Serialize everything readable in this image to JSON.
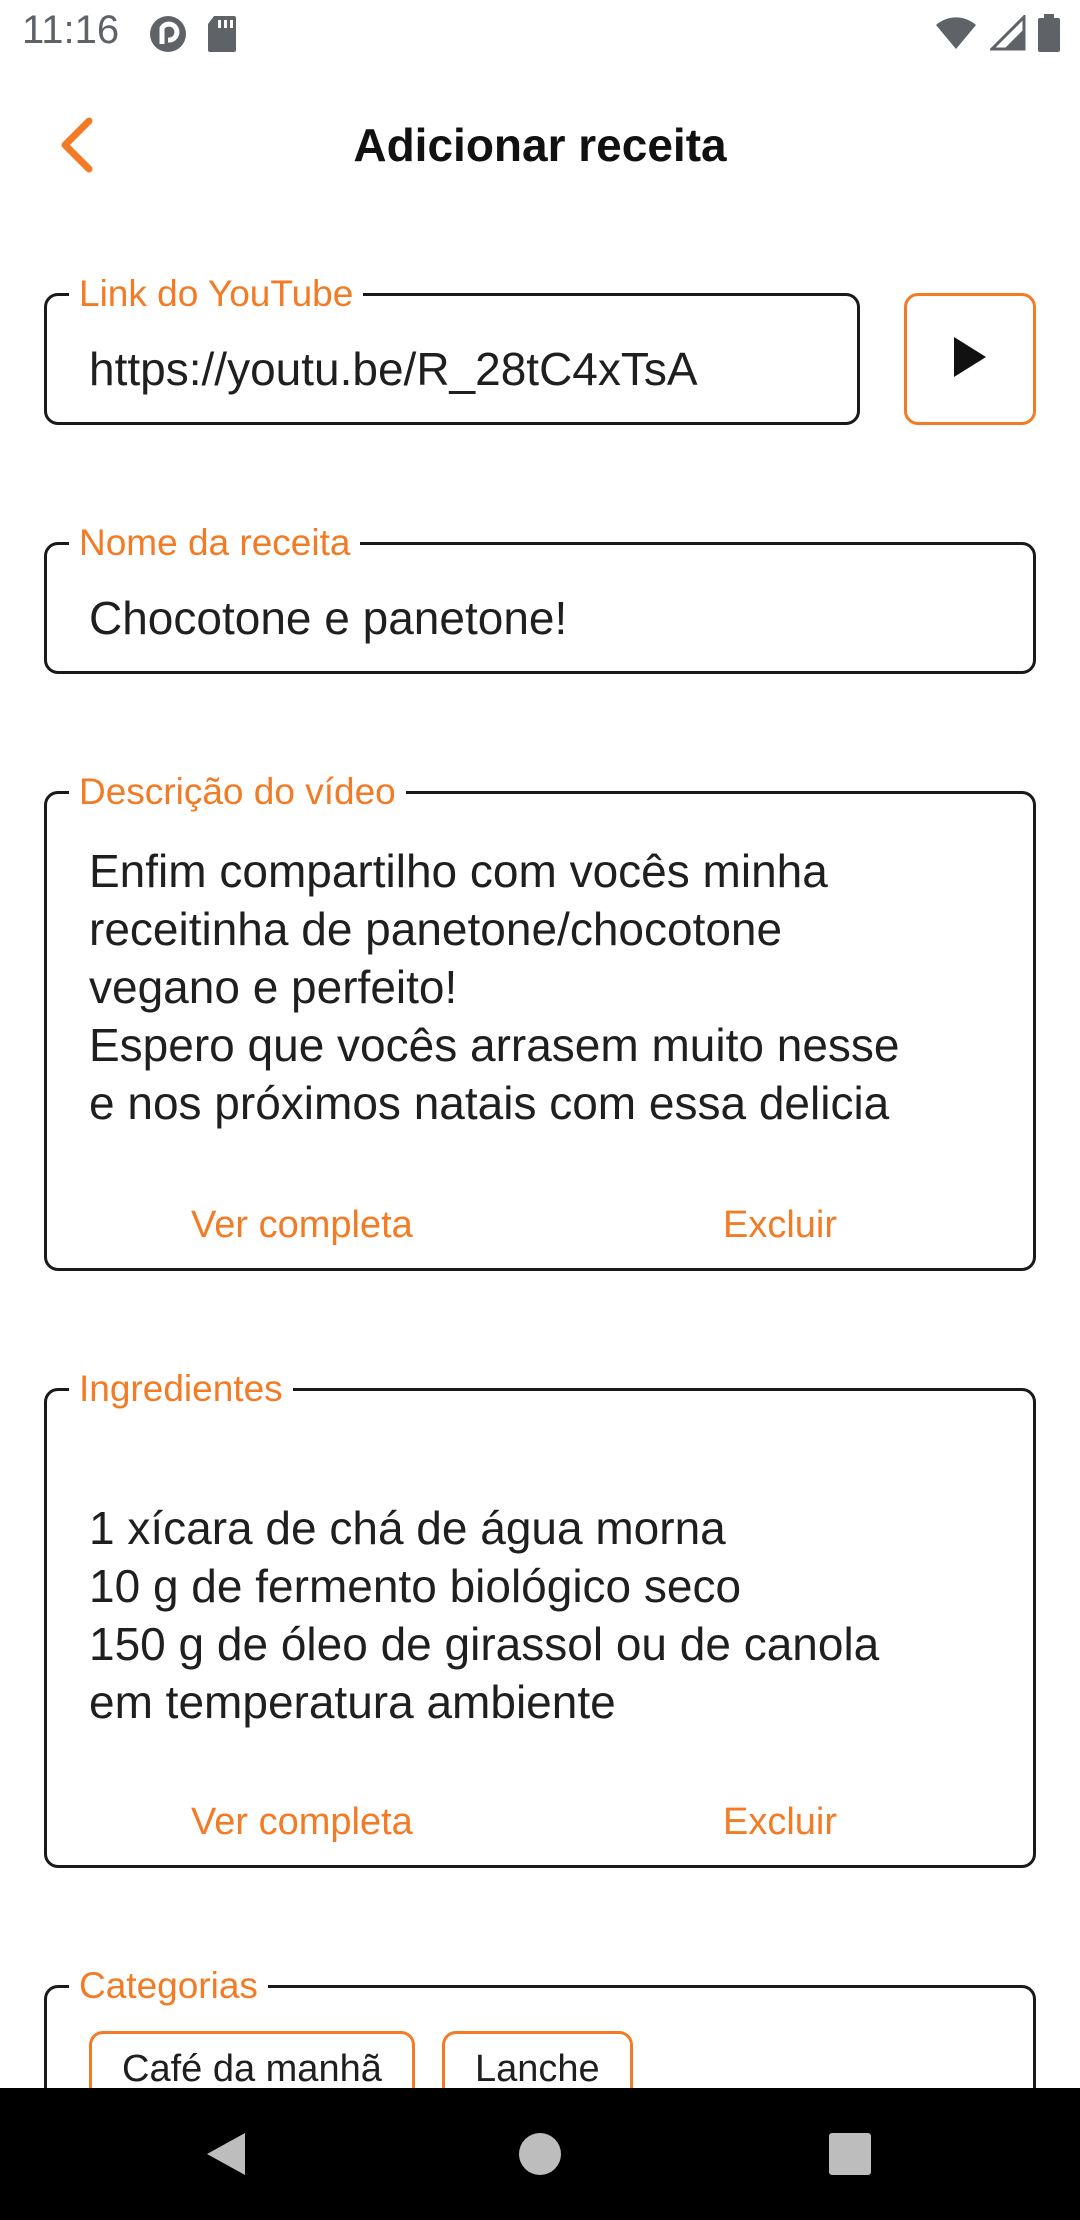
{
  "status_bar": {
    "time": "11:16",
    "left_icons": [
      "pocket-casts-icon",
      "sd-card-icon"
    ],
    "right_icons": [
      "wifi-icon",
      "signal-icon",
      "battery-icon"
    ]
  },
  "app_bar": {
    "title": "Adicionar receita",
    "back_icon": "chevron-left-icon"
  },
  "youtube_link": {
    "label": "Link do YouTube",
    "value": "https://youtu.be/R_28tC4xTsA"
  },
  "play_button": {
    "icon": "play-icon"
  },
  "recipe_name": {
    "label": "Nome da receita",
    "value": "Chocotone e panetone!"
  },
  "video_description": {
    "label": "Descrição do vídeo",
    "text": "Enfim compartilho com vocês minha\nreceitinha de panetone/chocotone\nvegano e perfeito!\nEspero que vocês arrasem muito nesse\ne nos próximos natais com essa delicia",
    "view_full": "Ver completa",
    "delete": "Excluir"
  },
  "ingredients": {
    "label": "Ingredientes",
    "text": "1 xícara de chá de água morna\n10 g de fermento biológico seco\n150 g de óleo de girassol ou de canola\nem temperatura ambiente",
    "view_full": "Ver completa",
    "delete": "Excluir"
  },
  "categories": {
    "label": "Categorias",
    "chips": [
      "Café da manhã",
      "Lanche"
    ]
  },
  "colors": {
    "accent": "#f47b25",
    "border": "#1a1a1a",
    "nav_bar": "#000000"
  }
}
